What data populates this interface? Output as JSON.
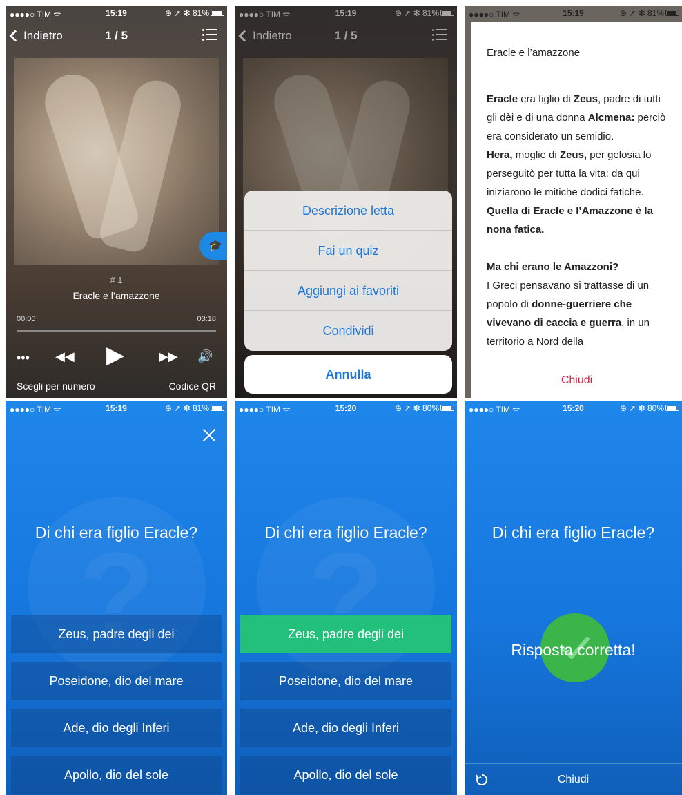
{
  "status": [
    {
      "carrier": "●●●●○ TIM ᯤ",
      "time": "15:19",
      "right": "⊕ ➚ ✻ 81%"
    },
    {
      "carrier": "●●●●○ TIM ᯤ",
      "time": "15:19",
      "right": "⊕ ➚ ✻ 81%"
    },
    {
      "carrier": "●●●●○ TIM ᯤ",
      "time": "15:19",
      "right": "⊕ ➚ ✻ 81%"
    },
    {
      "carrier": "●●●●○ TIM ᯤ",
      "time": "15:19",
      "right": "⊕ ➚ ✻ 81%"
    },
    {
      "carrier": "●●●●○ TIM ᯤ",
      "time": "15:20",
      "right": "⊕ ➚ ✻ 80%"
    },
    {
      "carrier": "●●●●○ TIM ᯤ",
      "time": "15:20",
      "right": "⊕ ➚ ✻ 80%"
    }
  ],
  "player": {
    "back_label": "Indietro",
    "counter": "1 / 5",
    "track_number": "# 1",
    "track_title": "Eracle e l’amazzone",
    "time_start": "00:00",
    "time_end": "03:18",
    "progress": 0,
    "more_icon": "•••",
    "rewind_icon": "◀◀",
    "play_icon": "▶",
    "forward_icon": "▶▶",
    "volume_icon": "🔊",
    "choose_number": "Scegli per numero",
    "qr_code": "Codice QR",
    "quiz_icon": "🎓"
  },
  "action_sheet": {
    "items": [
      "Descrizione letta",
      "Fai un quiz",
      "Aggiungi ai favoriti",
      "Condividi"
    ],
    "cancel": "Annulla"
  },
  "description": {
    "title": "Eracle e l’amazzone",
    "close": "Chiudi",
    "p1_a": "Eracle",
    "p1_b": " era figlio di ",
    "p1_c": "Zeus",
    "p1_d": ", padre di tutti gli dèi e di una donna ",
    "p1_e": "Alcmena:",
    "p1_f": " perciò era considerato un semidio.",
    "p2_a": "Hera,",
    "p2_b": " moglie di ",
    "p2_c": "Zeus,",
    "p2_d": " per gelosia lo perseguitò per tutta la vita: da qui iniziarono le mitiche dodici fatiche. ",
    "p2_e": "Quella di Eracle e l’Amazzone è la nona fatica.",
    "p3_a": "Ma chi erano le Amazzoni?",
    "p3_b": "I Greci pensavano si trattasse di un popolo di ",
    "p3_c": "donne-guerriere che vivevano di caccia e guerra",
    "p3_d": ", in un territorio a Nord della"
  },
  "quiz": {
    "question": "Di chi era figlio Eracle?",
    "answers": [
      "Zeus, padre degli dei",
      "Poseidone, dio del mare",
      "Ade, dio degli Inferi",
      "Apollo, dio del sole"
    ],
    "watermark": "?",
    "correct_text": "Risposta corretta!",
    "close": "Chiudi",
    "correct_color": "#22c07a"
  }
}
